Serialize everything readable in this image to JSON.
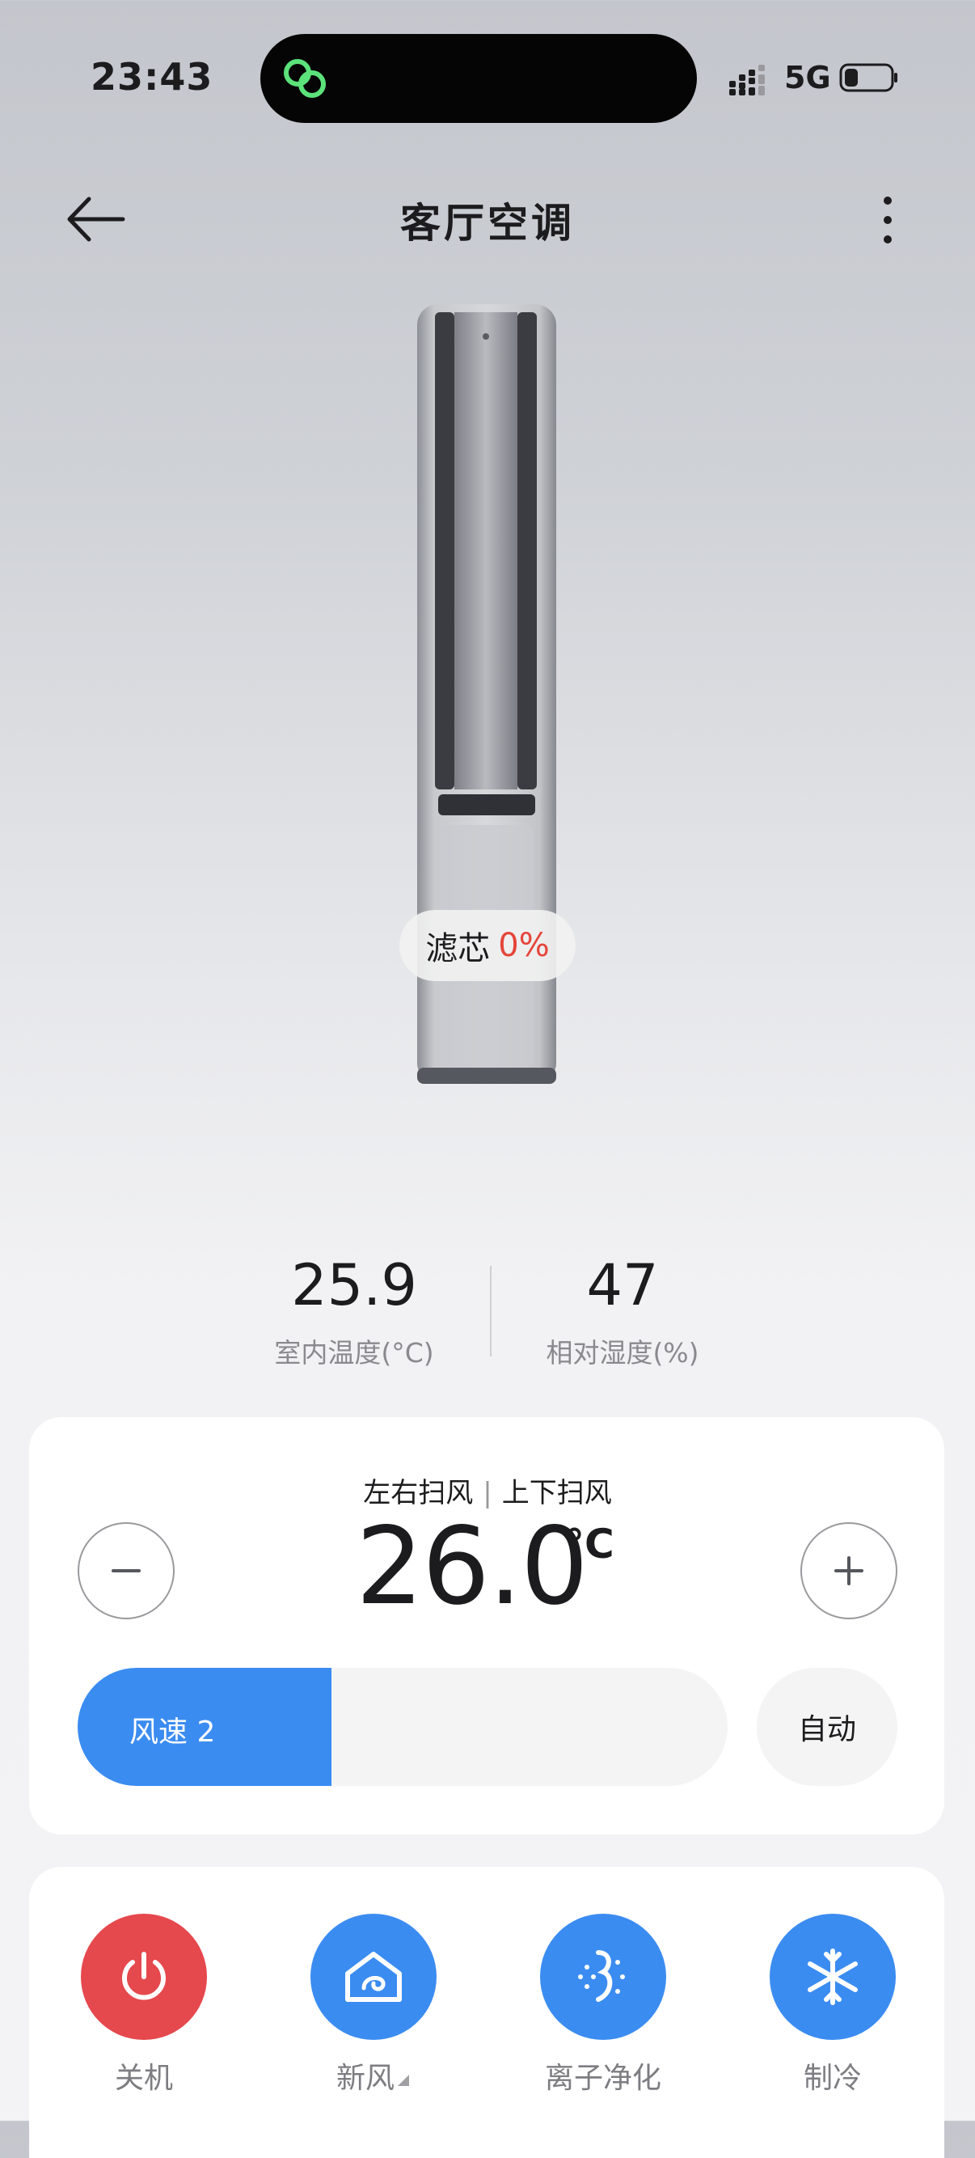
{
  "status_bar": {
    "time": "23:43",
    "network": "5G"
  },
  "header": {
    "title": "客厅空调"
  },
  "device": {
    "filter_label": "滤芯",
    "filter_value": "0%"
  },
  "stats": [
    {
      "value": "25.9",
      "label": "室内温度(°C)"
    },
    {
      "value": "47",
      "label": "相对湿度(%)"
    }
  ],
  "control": {
    "swing_lr": "左右扫风",
    "swing_ud": "上下扫风",
    "separator": "|",
    "temperature": "26.0",
    "temp_unit": "°C",
    "fan_speed_label": "风速 2",
    "fan_speed_fraction": 0.39,
    "auto_label": "自动"
  },
  "functions": [
    {
      "label": "关机",
      "icon": "power-icon",
      "color": "#e5484d"
    },
    {
      "label": "新风",
      "icon": "fresh-air-icon",
      "color": "#3b8cf1"
    },
    {
      "label": "离子净化",
      "icon": "ion-purify-icon",
      "color": "#3b8cf1"
    },
    {
      "label": "制冷",
      "icon": "snowflake-icon",
      "color": "#3b8cf1"
    }
  ]
}
